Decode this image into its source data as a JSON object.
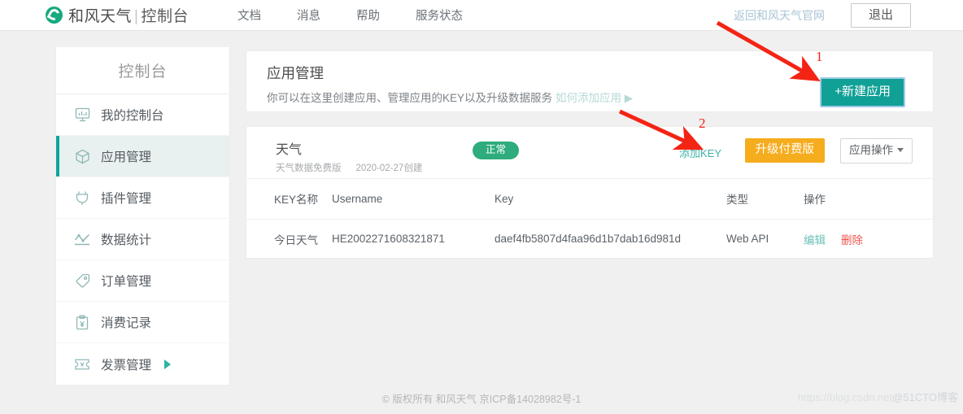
{
  "header": {
    "logo_icon": "hefeng-swirl-logo",
    "brand": "和风天气",
    "brand_separator": "|",
    "brand_sub": "控制台",
    "nav": [
      {
        "label": "文档"
      },
      {
        "label": "消息"
      },
      {
        "label": "帮助"
      },
      {
        "label": "服务状态"
      }
    ],
    "back_link": "返回和风天气官网",
    "logout_label": "退出"
  },
  "sidebar": {
    "title": "控制台",
    "items": [
      {
        "label": "我的控制台",
        "icon": "dashboard-chart-icon",
        "active": false
      },
      {
        "label": "应用管理",
        "icon": "cube-icon",
        "active": true
      },
      {
        "label": "插件管理",
        "icon": "plugin-icon",
        "active": false
      },
      {
        "label": "数据统计",
        "icon": "line-chart-icon",
        "active": false
      },
      {
        "label": "订单管理",
        "icon": "tag-icon",
        "active": false
      },
      {
        "label": "消费记录",
        "icon": "clipboard-yuan-icon",
        "active": false
      },
      {
        "label": "发票管理",
        "icon": "ticket-yuan-icon",
        "active": false,
        "caret": "▶"
      }
    ]
  },
  "main": {
    "page_title": "应用管理",
    "page_desc": "你可以在这里创建应用、管理应用的KEY以及升级数据服务",
    "howto_link": "如何添加应用 ▶",
    "new_app_label": "+新建应用",
    "app": {
      "name": "天气",
      "status": "正常",
      "plan": "天气数据免费版",
      "created": "2020-02-27创建",
      "add_key_label": "添加KEY",
      "upgrade_label": "升级付费版",
      "ops_label": "应用操作"
    },
    "table": {
      "columns": [
        "KEY名称",
        "Username",
        "Key",
        "类型",
        "操作"
      ],
      "rows": [
        {
          "key_name": "今日天气",
          "username": "HE2002271608321871",
          "key": "daef4fb5807d4faa96d1b7dab16d981d",
          "type": "Web API",
          "edit_label": "编辑",
          "delete_label": "删除"
        }
      ]
    }
  },
  "footer": {
    "copyright": "© 版权所有 和风天气 京ICP备14028982号-1",
    "watermark_url": "https://blog.csdn.net",
    "watermark_tag": "@51CTO博客"
  },
  "annotations": [
    {
      "number": "1",
      "target": "new-app-button"
    },
    {
      "number": "2",
      "target": "add-key-link"
    }
  ],
  "colors": {
    "brand_teal": "#11a096",
    "accent_green": "#2eac7d",
    "upgrade_orange": "#f5ac1d",
    "danger_red": "#f0544b",
    "annotation_red": "#f42414",
    "link_teal": "#3fb3a8"
  }
}
